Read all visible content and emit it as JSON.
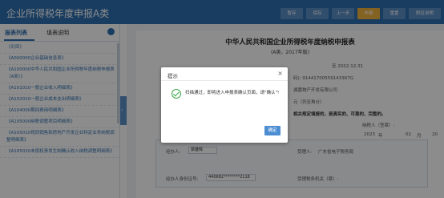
{
  "app": {
    "title": "企业所得税年度申报A类"
  },
  "toolbar": {
    "buttons": [
      {
        "label": "暂存",
        "state": "normal"
      },
      {
        "label": "保存",
        "state": "normal"
      },
      {
        "label": "上一步",
        "state": "normal"
      },
      {
        "label": "申报",
        "state": "active"
      },
      {
        "label": "重置",
        "state": "normal"
      },
      {
        "label": "附征说明",
        "state": "normal"
      }
    ],
    "accent_color": "#f0b33c",
    "bar_color": "#2f6fb0"
  },
  "sidebar": {
    "tabs": [
      "报表列表",
      "填表说明"
    ],
    "items": [
      "《封面》",
      "《A000000企业基础信息表》",
      "《A100000中华人民共和国企业所得税年度纳税申报表（A类）》",
      "《A101010一般企业收入明细表》",
      "《A102010一般企业成本支出明细表》",
      "《A104000期间费用明细表》",
      "《A105000纳税调整项目明细表》",
      "《A105010视同销售和房地产开发企业特定业务纳税调整明细表》",
      "《A105020未按权责发生制确认收入纳税调整明细表》"
    ]
  },
  "document": {
    "title": "中华人民共和国企业所得税年度纳税申报表",
    "subtitle": "(A类，2017年版)",
    "period_end": "至  2022-12-31",
    "tax_id": "码): 91441700559143367G",
    "company": "湖嘉物产开发有限公司",
    "unit_note": "元（列至角分）",
    "declaration": "相关规定填报的，是真实的、可靠的、完整的。",
    "signatory": "纳税人（签章）:",
    "date_year": "2023",
    "date_year_unit": "年",
    "date_month": "02",
    "date_month_unit": "月",
    "date_day": "20",
    "agent_label": "经办人:",
    "agent_value": "梁雄辉",
    "agent_id_label": "经办人身份证号:",
    "agent_id_value": "440682********2118",
    "acceptor_label": "受理人:",
    "acceptor_value": "广东省电子税务局",
    "tax_office_label": "受理税务机关（章）:"
  },
  "dialog": {
    "title": "提示",
    "close": "×",
    "icon": "success-check-icon",
    "message": "扫描通过，即将进入申报表确认页面，请\"确认\"!",
    "ok_label": "确定"
  }
}
